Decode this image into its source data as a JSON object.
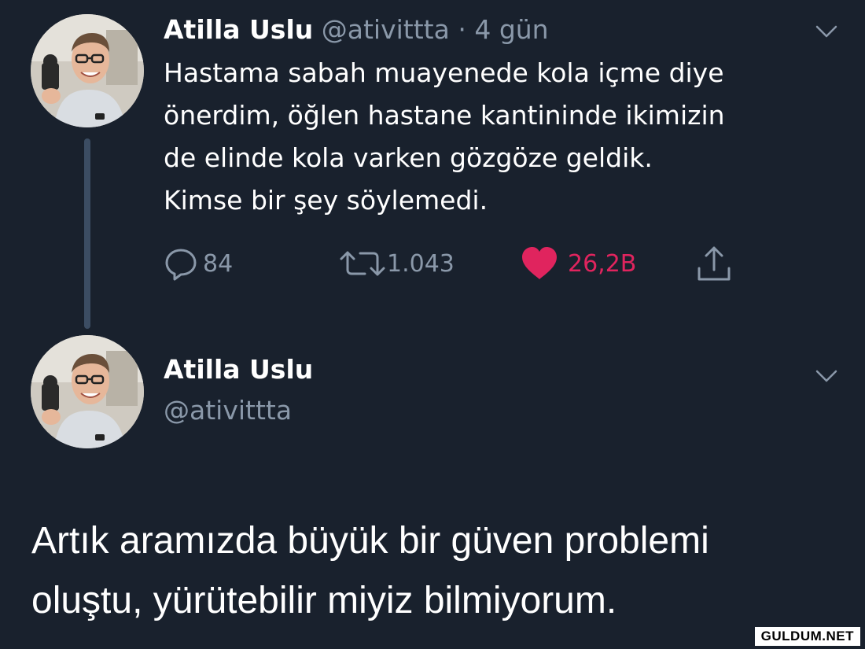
{
  "tweet": {
    "display_name": "Atilla Uslu",
    "handle": "@ativittta",
    "time_separator": "·",
    "time": "4 gün",
    "text_lines": [
      "Hastama sabah muayenede kola içme diye",
      "önerdim, öğlen hastane kantininde ikimizin",
      "de elinde kola varken gözgöze geldik.",
      "Kimse bir şey söylemedi."
    ],
    "actions": {
      "reply": {
        "icon": "reply-icon",
        "count": "84"
      },
      "retweet": {
        "icon": "retweet-icon",
        "count": "1.043"
      },
      "like": {
        "icon": "heart-icon",
        "count": "26,2B",
        "color": "#e0245e"
      },
      "share": {
        "icon": "share-icon"
      }
    }
  },
  "reply": {
    "display_name": "Atilla Uslu",
    "handle": "@ativittta",
    "text_lines": [
      "Artık aramızda büyük bir güven problemi",
      "oluştu, yürütebilir miyiz bilmiyorum."
    ]
  },
  "watermark": "GULDUM.NET",
  "colors": {
    "background": "#19212d",
    "secondary_text": "#8a98a9",
    "thread_line": "#3c4d63",
    "like": "#e0245e"
  }
}
